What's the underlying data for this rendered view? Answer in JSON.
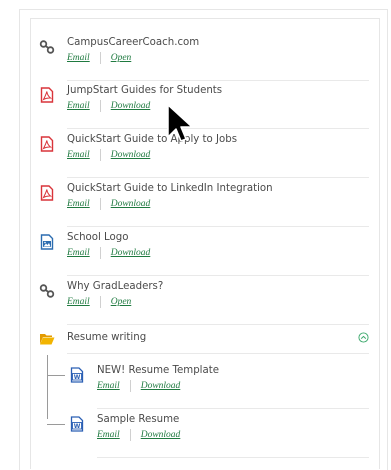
{
  "items": [
    {
      "title": "CampusCareerCoach.com",
      "icon": "link-icon",
      "links": [
        "Email",
        "Open"
      ]
    },
    {
      "title": "JumpStart Guides for Students",
      "icon": "pdf-icon",
      "links": [
        "Email",
        "Download"
      ]
    },
    {
      "title": "QuickStart Guide to Apply to Jobs",
      "icon": "pdf-icon",
      "links": [
        "Email",
        "Download"
      ]
    },
    {
      "title": "QuickStart Guide to LinkedIn Integration",
      "icon": "pdf-icon",
      "links": [
        "Email",
        "Download"
      ]
    },
    {
      "title": "School Logo",
      "icon": "image-icon",
      "links": [
        "Email",
        "Download"
      ]
    },
    {
      "title": "Why GradLeaders?",
      "icon": "link-icon",
      "links": [
        "Email",
        "Open"
      ]
    }
  ],
  "folder": {
    "title": "Resume writing",
    "icon": "folder-open-icon",
    "toggle_icon": "chevron-up-icon"
  },
  "children": [
    {
      "title": "NEW! Resume Template",
      "icon": "word-doc-icon",
      "links": [
        "Email",
        "Download"
      ]
    },
    {
      "title": "Sample Resume",
      "icon": "word-doc-icon",
      "links": [
        "Email",
        "Download"
      ]
    }
  ],
  "colors": {
    "link": "#1f7a40",
    "pdf": "#d9343a",
    "folder": "#f2a900",
    "word": "#2b5fb4",
    "image": "#2b6cb0",
    "chevron": "#3aa86b"
  }
}
